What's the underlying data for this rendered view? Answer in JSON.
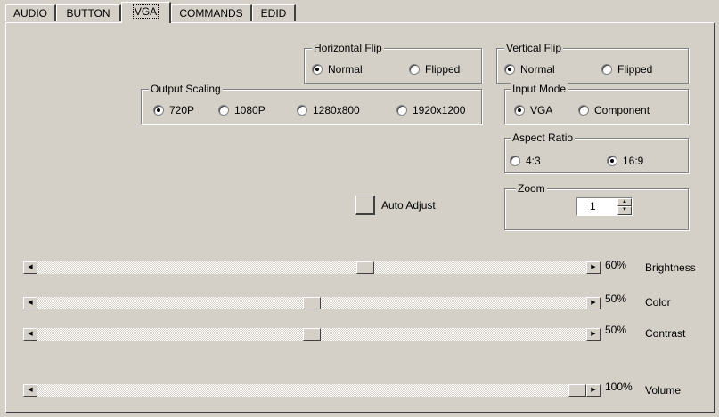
{
  "tabs": [
    {
      "label": "AUDIO",
      "active": false
    },
    {
      "label": "BUTTON",
      "active": false
    },
    {
      "label": "VGA",
      "active": true
    },
    {
      "label": "COMMANDS",
      "active": false
    },
    {
      "label": "EDID",
      "active": false
    }
  ],
  "horizontal_flip": {
    "title": "Horizontal Flip",
    "options": [
      "Normal",
      "Flipped"
    ],
    "selected": "Normal"
  },
  "vertical_flip": {
    "title": "Vertical Flip",
    "options": [
      "Normal",
      "Flipped"
    ],
    "selected": "Normal"
  },
  "output_scaling": {
    "title": "Output Scaling",
    "options": [
      "720P",
      "1080P",
      "1280x800",
      "1920x1200"
    ],
    "selected": "720P"
  },
  "input_mode": {
    "title": "Input Mode",
    "options": [
      "VGA",
      "Component"
    ],
    "selected": "VGA"
  },
  "aspect_ratio": {
    "title": "Aspect Ratio",
    "options": [
      "4:3",
      "16:9"
    ],
    "selected": "16:9"
  },
  "zoom": {
    "title": "Zoom",
    "value": "1"
  },
  "auto_adjust": {
    "label": "Auto Adjust"
  },
  "sliders": [
    {
      "label": "Brightness",
      "value_text": "60%",
      "value": 60
    },
    {
      "label": "Color",
      "value_text": "50%",
      "value": 50
    },
    {
      "label": "Contrast",
      "value_text": "50%",
      "value": 50
    },
    {
      "label": "Volume",
      "value_text": "100%",
      "value": 100
    }
  ],
  "colors": {
    "window_bg": "#d4d0c8",
    "shadow": "#404040",
    "highlight": "#ffffff"
  }
}
